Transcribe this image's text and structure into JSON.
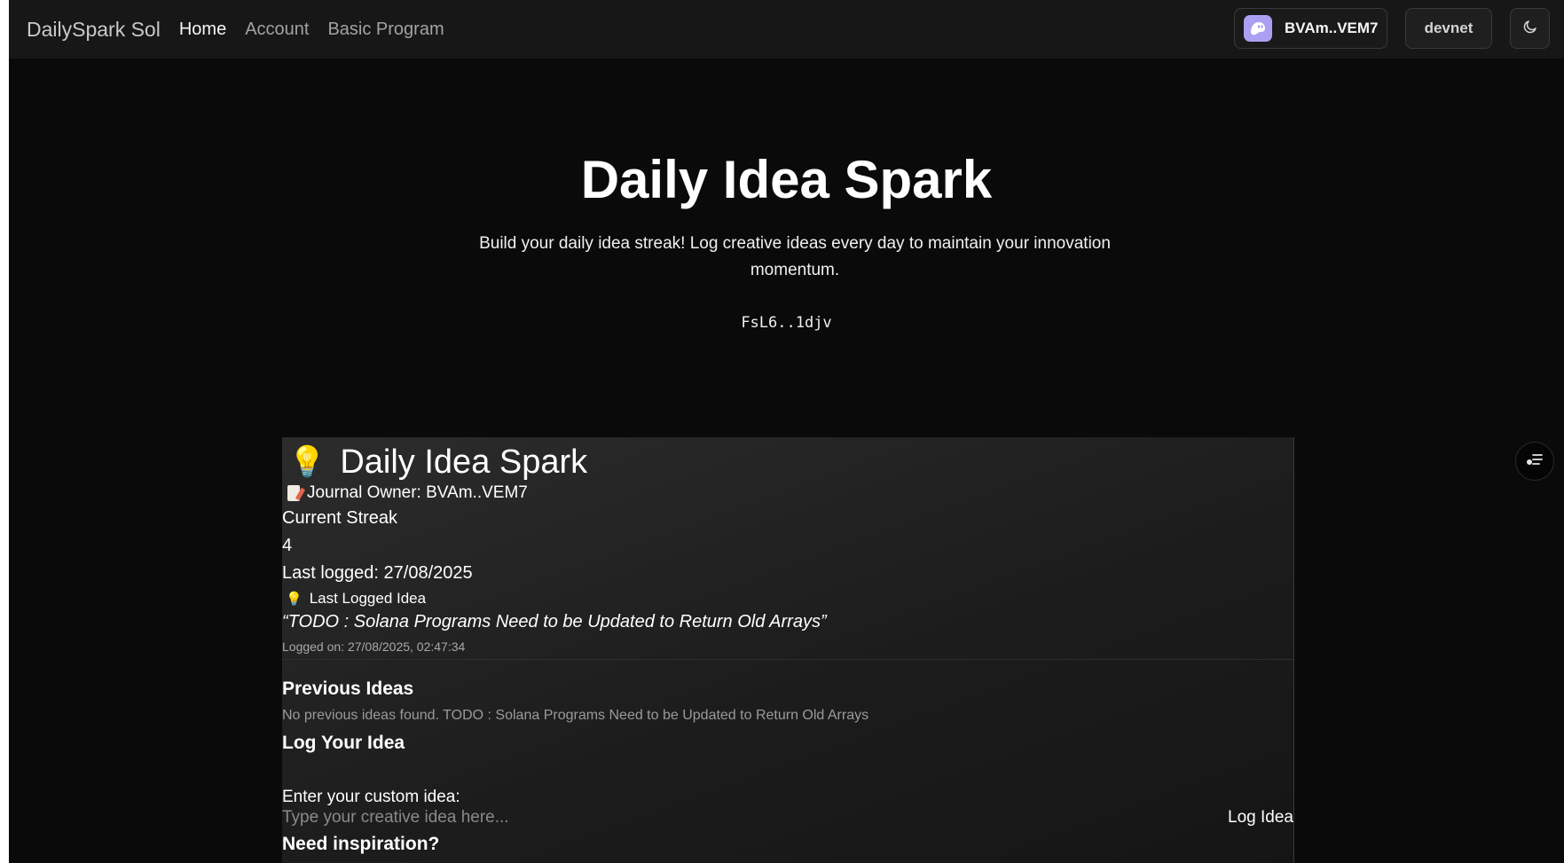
{
  "navbar": {
    "brand": "DailySpark Sol",
    "links": [
      {
        "label": "Home",
        "active": true
      },
      {
        "label": "Account",
        "active": false
      },
      {
        "label": "Basic Program",
        "active": false
      }
    ],
    "wallet_label": "BVAm..VEM7",
    "wallet_icon": "phantom-ghost-icon",
    "cluster_label": "devnet",
    "theme_icon": "moon-icon"
  },
  "hero": {
    "title": "Daily Idea Spark",
    "subtitle": "Build your daily idea streak! Log creative ideas every day to maintain your innovation momentum.",
    "program_id": "FsL6..1djv"
  },
  "card": {
    "title_icon": "💡",
    "title": "Daily Idea Spark",
    "owner_text": "Journal Owner: BVAm..VEM7",
    "streak_label": "Current Streak",
    "streak_value": "4",
    "last_logged": "Last logged: 27/08/2025",
    "last_idea_icon": "💡",
    "last_idea_label": "Last Logged Idea",
    "last_idea_text": "“TODO : Solana Programs Need to be Updated to Return Old Arrays”",
    "logged_on": "Logged on: 27/08/2025, 02:47:34",
    "previous_heading": "Previous Ideas",
    "previous_empty": "No previous ideas found. TODO : Solana Programs Need to be Updated to Return Old Arrays",
    "log_heading": "Log Your Idea",
    "input_label": "Enter your custom idea:",
    "input_placeholder": "Type your creative idea here...",
    "input_value": "",
    "log_button": "Log Idea",
    "inspiration_heading": "Need inspiration?"
  },
  "floating_button_icon": "list-settings-icon",
  "colors": {
    "page_bg": "#0a0a0a",
    "navbar_bg": "#171717",
    "wallet_accent": "#ab9ff2",
    "text_primary": "#ffffff",
    "text_muted": "#9a9a9a"
  }
}
